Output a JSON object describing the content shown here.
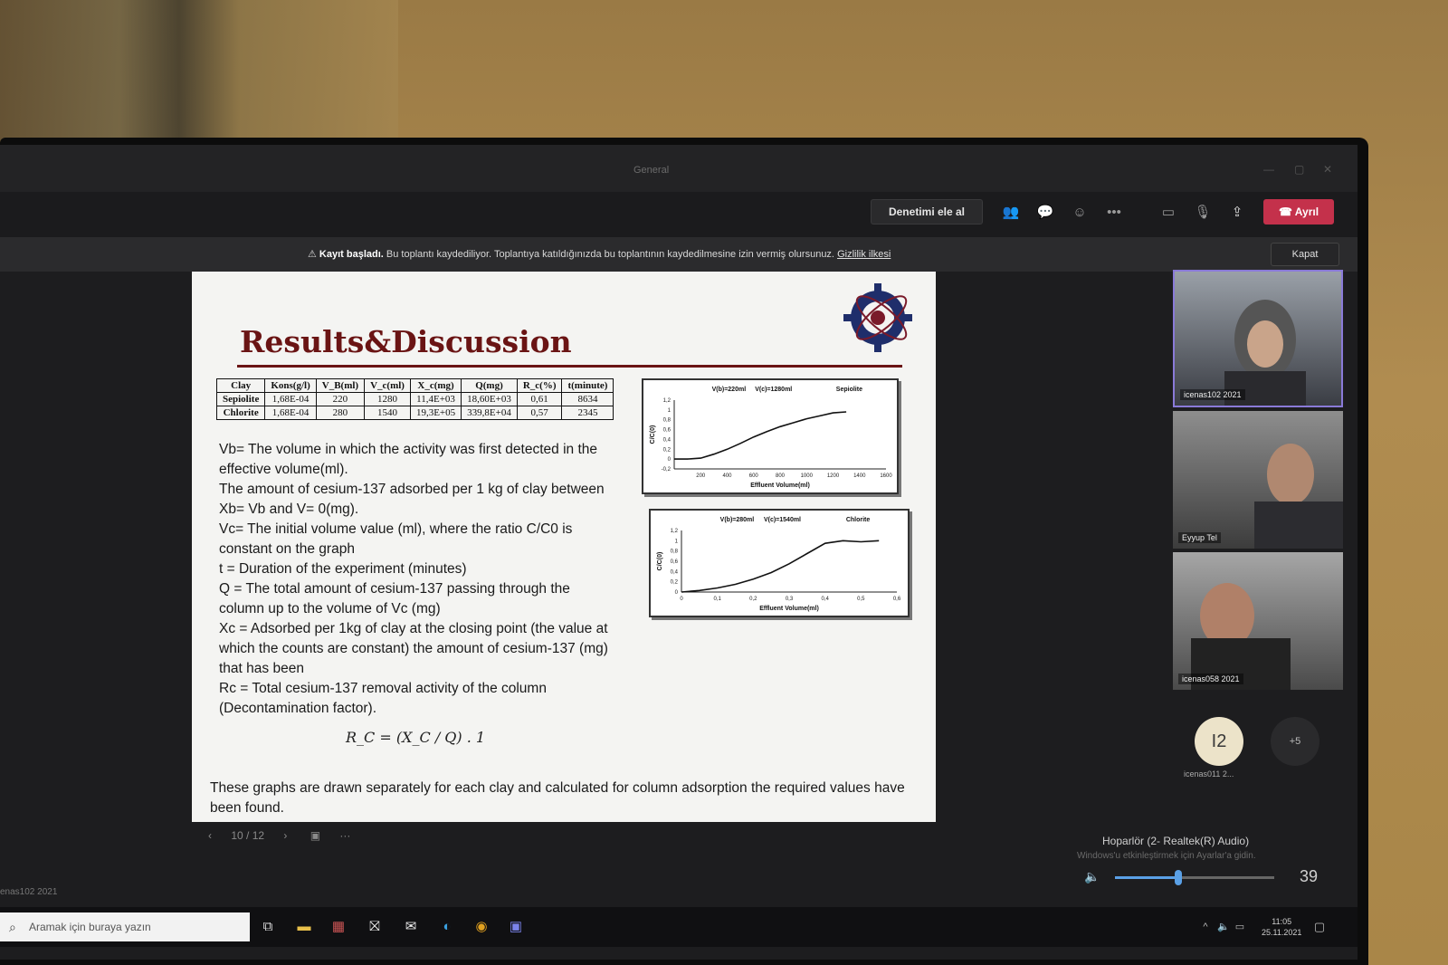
{
  "window": {
    "title": "General"
  },
  "toolbar": {
    "take_control": "Denetimi ele al",
    "leave": "Ayrıl",
    "more": "•••"
  },
  "banner": {
    "title": "Kayıt başladı.",
    "message": "Bu toplantı kaydediliyor. Toplantıya katıldığınızda bu toplantının kaydedilmesine izin vermiş olursunuz.",
    "link": "Gizlilik ilkesi",
    "close": "Kapat"
  },
  "slide": {
    "title": "Results&Discussion",
    "table": {
      "headers": [
        "Clay",
        "Kons(g/l)",
        "V_B(ml)",
        "V_c(ml)",
        "X_c(mg)",
        "Q(mg)",
        "R_c(%)",
        "t(minute)"
      ],
      "rows": [
        [
          "Sepiolite",
          "1,68E-04",
          "220",
          "1280",
          "11,4E+03",
          "18,60E+03",
          "0,61",
          "8634"
        ],
        [
          "Chlorite",
          "1,68E-04",
          "280",
          "1540",
          "19,3E+05",
          "339,8E+04",
          "0,57",
          "2345"
        ]
      ]
    },
    "definitions": [
      "Vb= The volume in which the activity was first detected in the effective volume(ml).",
      "The amount of cesium-137 adsorbed per 1 kg of clay between Xb= Vb and V= 0(mg).",
      "Vc= The initial volume value (ml), where the ratio C/C0 is constant on the graph",
      "t = Duration of the experiment (minutes)",
      "Q = The total amount of cesium-137 passing through the column up to the volume of Vc (mg)",
      "Xc = Adsorbed per 1kg of clay at the closing point (the value at which the counts are constant) the amount of cesium-137 (mg) that has been",
      "Rc = Total cesium-137 removal activity of the column (Decontamination factor)."
    ],
    "formula": "R_C = (X_C / Q) . 1",
    "footer": "These graphs are drawn separately for each clay and calculated for column adsorption the required values have been found.",
    "nav": {
      "page": "10 / 12",
      "more": "···"
    }
  },
  "chart_data": [
    {
      "type": "line",
      "title": "Sepiolite",
      "annotations": [
        "V(b)=220ml",
        "V(c)=1280ml"
      ],
      "xlabel": "Effluent Volume(ml)",
      "ylabel": "C/C(0)",
      "x_ticks": [
        "200",
        "400",
        "600",
        "800",
        "1000",
        "1200",
        "1400",
        "1600"
      ],
      "y_ticks": [
        "1,2",
        "1",
        "0,8",
        "0,6",
        "0,4",
        "0,2",
        "0",
        "-0,2"
      ],
      "xlim": [
        0,
        1600
      ],
      "ylim": [
        -0.2,
        1.2
      ],
      "x": [
        0,
        100,
        200,
        300,
        400,
        500,
        600,
        700,
        800,
        900,
        1000,
        1100,
        1200,
        1300
      ],
      "y": [
        0,
        0,
        0.02,
        0.1,
        0.2,
        0.32,
        0.45,
        0.56,
        0.66,
        0.74,
        0.82,
        0.88,
        0.94,
        0.96
      ]
    },
    {
      "type": "line",
      "title": "Chlorite",
      "annotations": [
        "V(b)=280ml",
        "V(c)=1540ml"
      ],
      "xlabel": "Effluent Volume(ml)",
      "ylabel": "C/C(0)",
      "x_ticks": [
        "0",
        "0,1",
        "0,2",
        "0,3",
        "0,4",
        "0,5",
        "0,6"
      ],
      "y_ticks": [
        "1,2",
        "1",
        "0,8",
        "0,6",
        "0,4",
        "0,2",
        "0"
      ],
      "xlim": [
        0,
        0.6
      ],
      "ylim": [
        0,
        1.2
      ],
      "x": [
        0,
        0.05,
        0.1,
        0.15,
        0.2,
        0.25,
        0.3,
        0.35,
        0.4,
        0.45,
        0.5,
        0.55
      ],
      "y": [
        0,
        0.03,
        0.08,
        0.15,
        0.25,
        0.38,
        0.55,
        0.75,
        0.95,
        1.0,
        0.98,
        1.0
      ]
    }
  ],
  "participants": [
    {
      "name": "icenas102 2021",
      "active": true
    },
    {
      "name": "Eyyup Tel",
      "active": false
    },
    {
      "name": "icenas058 2021",
      "active": false
    }
  ],
  "avatar": {
    "initials": "I2",
    "name": "icenas011 2...",
    "more": "+5"
  },
  "left_label": "enas102 2021",
  "volume": {
    "device": "Hoparlör (2- Realtek(R) Audio)",
    "level": 39,
    "watermark": "Windows'u etkinleştirmek için Ayarlar'a gidin."
  },
  "taskbar": {
    "search_placeholder": "Aramak için buraya yazın",
    "time": "11:05",
    "date": "25.11.2021"
  },
  "colors": {
    "title": "#6a1414",
    "leave": "#c4314b",
    "active_border": "#8a7ad8"
  }
}
